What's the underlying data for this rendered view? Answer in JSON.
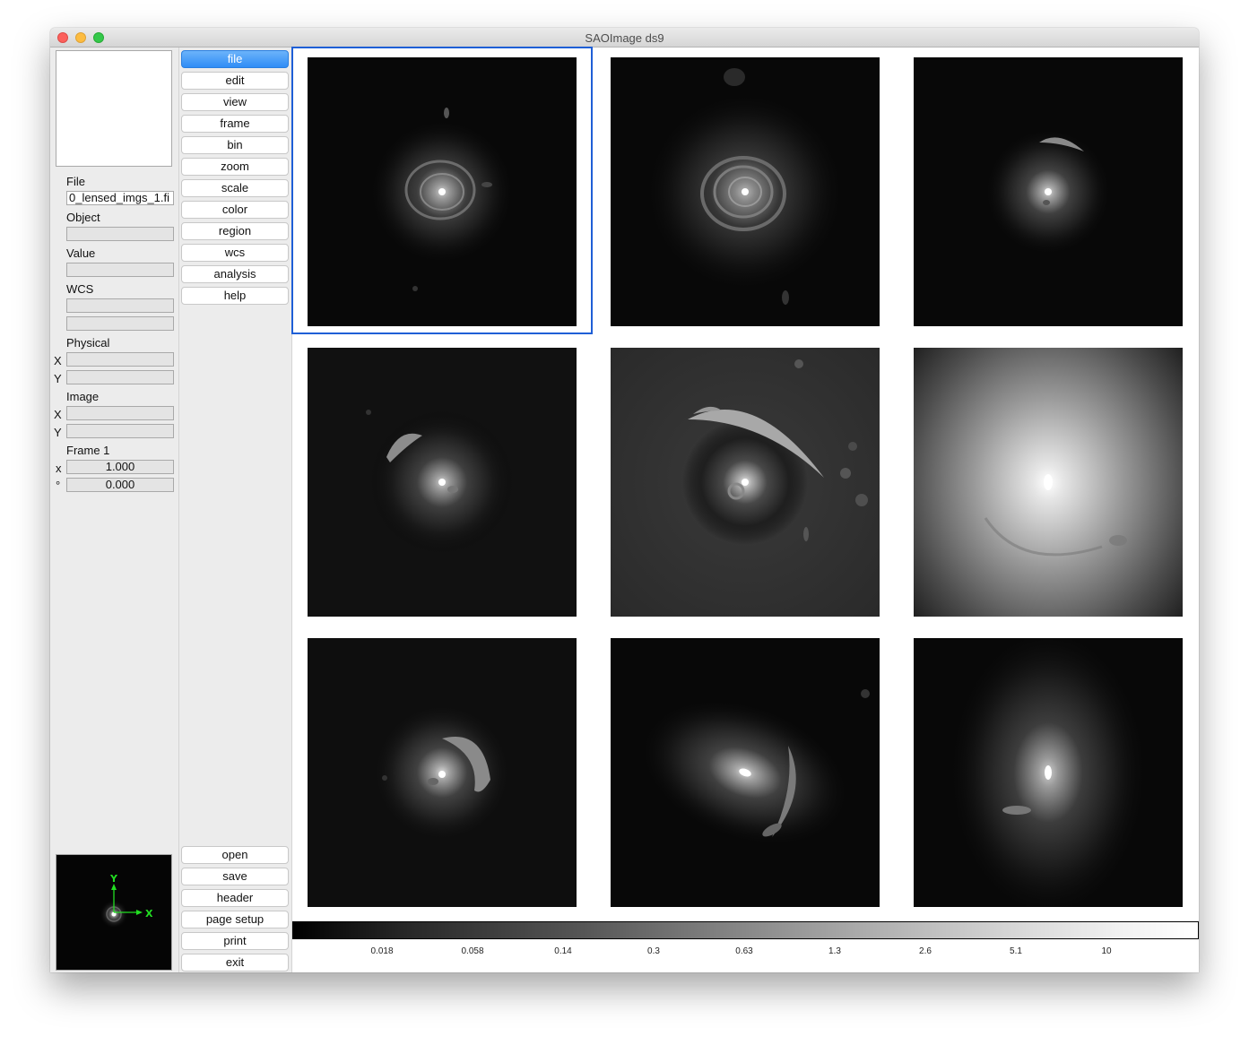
{
  "window": {
    "title": "SAOImage ds9"
  },
  "info_panel": {
    "file_label": "File",
    "file_value": "0_lensed_imgs_1.fi",
    "object_label": "Object",
    "value_label": "Value",
    "wcs_label": "WCS",
    "physical_label": "Physical",
    "physical_x_label": "X",
    "physical_y_label": "Y",
    "image_label": "Image",
    "image_x_label": "X",
    "image_y_label": "Y",
    "frame_label": "Frame 1",
    "zoom_symbol": "x",
    "zoom_value": "1.000",
    "angle_symbol": "°",
    "angle_value": "0.000"
  },
  "panner": {
    "y_label": "Y",
    "x_label": "X",
    "axis_color": "#22dd22"
  },
  "buttons": {
    "top": [
      "file",
      "edit",
      "view",
      "frame",
      "bin",
      "zoom",
      "scale",
      "color",
      "region",
      "wcs",
      "analysis",
      "help"
    ],
    "active": "file",
    "bottom": [
      "open",
      "save",
      "header",
      "page setup",
      "print",
      "exit"
    ]
  },
  "frames": {
    "count": 9,
    "current_frame": 1,
    "accent_color": "#1f5fd6"
  },
  "colorbar": {
    "ticks": [
      "0.018",
      "0.058",
      "0.14",
      "0.3",
      "0.63",
      "1.3",
      "2.6",
      "5.1",
      "10"
    ]
  }
}
